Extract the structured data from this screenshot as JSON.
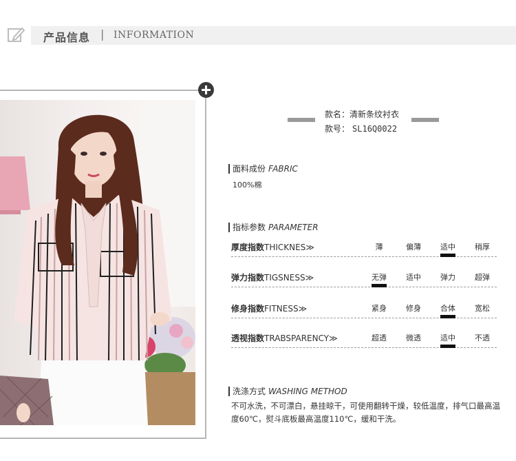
{
  "header": {
    "title_cn": "产品信息",
    "separator": "|",
    "title_en": "INFORMATION"
  },
  "product": {
    "name_label": "款名：",
    "name_value": "清新条纹衬衣",
    "no_label": "款号：",
    "no_value": "SL16Q0022"
  },
  "fabric": {
    "heading_cn": "面料成份",
    "heading_en": "FABRIC",
    "value": "100%棉"
  },
  "parameter": {
    "heading_cn": "指标参数",
    "heading_en": "PARAMETER",
    "rows": [
      {
        "label_cn": "厚度指数",
        "label_en": "THICKNES≫",
        "options": [
          "薄",
          "偏薄",
          "适中",
          "稍厚"
        ],
        "selected": 2
      },
      {
        "label_cn": "弹力指数",
        "label_en": "TIGSNESS≫",
        "options": [
          "无弹",
          "适中",
          "弹力",
          "超弹"
        ],
        "selected": 0
      },
      {
        "label_cn": "修身指数",
        "label_en": "FITNESS≫",
        "options": [
          "紧身",
          "修身",
          "合体",
          "宽松"
        ],
        "selected": 2
      },
      {
        "label_cn": "透视指数",
        "label_en": "TRABSPARENCY≫",
        "options": [
          "超透",
          "微透",
          "适中",
          "不透"
        ],
        "selected": 2
      }
    ]
  },
  "washing": {
    "heading_cn": "洗涤方式",
    "heading_en": "WASHING METHOD",
    "text": "不可水洗，不可漂白，悬挂晾干，可使用翻转干燥，较低温度，排气口最高温度60℃，熨斗底板最高温度110℃，缓和干洗。"
  },
  "icons": {
    "header_icon": "edit-icon",
    "frame_badge": "plus-icon"
  },
  "colors": {
    "header_bar": "#f0f0f0",
    "accent_line": "#9a9a9a",
    "selected_mark": "#111111"
  }
}
